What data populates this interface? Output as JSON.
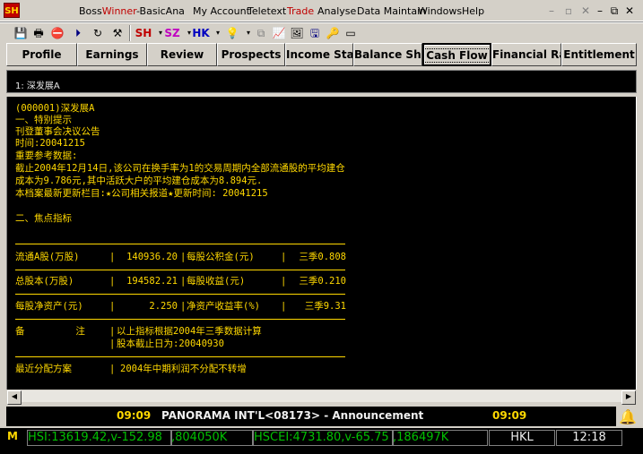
{
  "window": {
    "logo": "SH",
    "title_prefix": "Boss",
    "title_highlight": "Winner",
    "title_suffix": "-BasicAna",
    "menu": [
      "My Account",
      "Teletext",
      "Trade",
      "Analyse",
      "Data Maintain",
      "Windows",
      "Help"
    ],
    "active_menu": "Trade"
  },
  "toolbar": {
    "market_buttons": [
      "SH",
      "SZ",
      "HK"
    ]
  },
  "tabs": [
    "Profile",
    "Earnings",
    "Review",
    "Prospects",
    "Income State",
    "Balance Shee",
    "Cash Flow",
    "Financial Rati",
    "Entitlement"
  ],
  "active_tab": "Cash Flow",
  "stock_bar": {
    "label": "1: 深发展A"
  },
  "content": {
    "lines": [
      "(000001)深发展A",
      "一、特别提示",
      "刊登董事会决议公告",
      "时间:20041215",
      "重要参考数据:",
      "截止2004年12月14日,该公司在换手率为1的交易周期内全部流通股的平均建仓",
      "成本为9.786元,其中活跃大户的平均建仓成本为8.894元.",
      "本档案最新更新栏目:★公司相关报道★更新时间: 20041215",
      "",
      "二、焦点指标"
    ],
    "table": {
      "rows": [
        {
          "label": "流通A股(万股)",
          "value": "140936.20",
          "label2": "每股公积金(元)",
          "value2": "三季0.808"
        },
        {
          "label": "总股本(万股)",
          "value": "194582.21",
          "label2": "每股收益(元)",
          "value2": "三季0.210"
        },
        {
          "label": "每股净资产(元)",
          "value": "2.250",
          "label2": "净资产收益率(%)",
          "value2": "三季9.31"
        }
      ],
      "notes_label": "备         注",
      "notes_line1": "以上指标根据2004年三季数据计算",
      "notes_line2": "股本截止日为:20040930",
      "dist_label": "最近分配方案",
      "dist_value": "2004年中期利润不分配不转增"
    }
  },
  "ticker": {
    "time_left": "09:09",
    "message": "PANORAMA INT'L<08173> - Announcement",
    "time_right": "09:09"
  },
  "status": {
    "hsi": "HSI:13619.42,v-152.98",
    "hsi_vol": ",804050K",
    "hscei": "HSCEI:4731.80,v-65.75",
    "hscei_vol": ",186497K",
    "market": "HKL",
    "clock": "12:18"
  },
  "colors": {
    "text": "#ffd800",
    "background": "#000000",
    "index_green": "#00c000"
  }
}
